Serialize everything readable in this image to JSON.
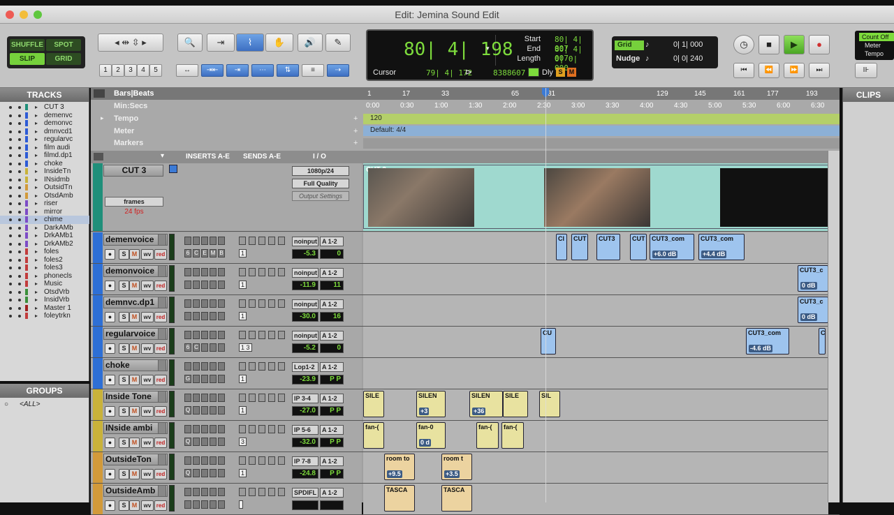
{
  "window": {
    "title": "Edit: Jemina Sound Edit"
  },
  "edit_modes": {
    "shuffle": "SHUFFLE",
    "spot": "SPOT",
    "slip": "SLIP",
    "grid": "GRID"
  },
  "zoom_presets": [
    "1",
    "2",
    "3",
    "4",
    "5"
  ],
  "counter": {
    "main": "80| 4| 198",
    "start_label": "Start",
    "start": "80| 4| 007",
    "end_label": "End",
    "end": "80| 4| 007",
    "length_label": "Length",
    "length": "0| 0| 000",
    "cursor_label": "Cursor",
    "cursor": "79| 4| 172",
    "sample": "8388607",
    "dly": "Dly",
    "s": "S",
    "m": "M"
  },
  "grid": {
    "grid_label": "Grid",
    "grid_value": "0| 1| 000",
    "nudge_label": "Nudge",
    "nudge_value": "0| 0| 240"
  },
  "count_off": {
    "line1": "Count Off",
    "line2": "Meter",
    "line3": "Tempo"
  },
  "tracks_panel": {
    "header": "TRACKS",
    "items": [
      {
        "name": "CUT 3",
        "color": "#1f8f7a"
      },
      {
        "name": "demenvc",
        "color": "#2d5bd6"
      },
      {
        "name": "demonvc",
        "color": "#2d5bd6"
      },
      {
        "name": "dmnvcd1",
        "color": "#2d5bd6"
      },
      {
        "name": "regularvc",
        "color": "#2d5bd6"
      },
      {
        "name": "film audi",
        "color": "#2d5bd6"
      },
      {
        "name": "filmd.dp1",
        "color": "#2d5bd6"
      },
      {
        "name": "choke",
        "color": "#2d5bd6"
      },
      {
        "name": "InsideTn",
        "color": "#c9b23a"
      },
      {
        "name": "INsidmb",
        "color": "#c9b23a"
      },
      {
        "name": "OutsidTn",
        "color": "#d29a3a"
      },
      {
        "name": "OtsdAmb",
        "color": "#d29a3a"
      },
      {
        "name": "riser",
        "color": "#7d4cc7"
      },
      {
        "name": "mirror",
        "color": "#7d4cc7"
      },
      {
        "name": "chime",
        "color": "#7d4cc7"
      },
      {
        "name": "DarkAMb",
        "color": "#7d4cc7"
      },
      {
        "name": "DrkAMb1",
        "color": "#7d4cc7"
      },
      {
        "name": "DrkAMb2",
        "color": "#7d4cc7"
      },
      {
        "name": "foles",
        "color": "#c23c3c"
      },
      {
        "name": "foles2",
        "color": "#c23c3c"
      },
      {
        "name": "foles3",
        "color": "#c23c3c"
      },
      {
        "name": "phonecls",
        "color": "#c23c3c"
      },
      {
        "name": "Music",
        "color": "#c23c3c"
      },
      {
        "name": "OtsdVrb",
        "color": "#3a8f3a"
      },
      {
        "name": "InsidVrb",
        "color": "#3a8f3a"
      },
      {
        "name": "Master 1",
        "color": "#a02020"
      },
      {
        "name": "foleytrkn",
        "color": "#c23c3c"
      }
    ]
  },
  "groups_panel": {
    "header": "GROUPS",
    "item": "<ALL>"
  },
  "clips_panel": {
    "header": "CLIPS"
  },
  "rulers": {
    "bars_beats": "Bars|Beats",
    "min_secs": "Min:Secs",
    "tempo": "Tempo",
    "meter": "Meter",
    "markers": "Markers",
    "tempo_value": "120",
    "meter_value": "Default: 4/4",
    "bar_ticks": [
      "1",
      "17",
      "33",
      "65",
      "81",
      "129",
      "145",
      "161",
      "177",
      "193"
    ],
    "time_ticks": [
      "0:00",
      "0:30",
      "1:00",
      "1:30",
      "2:00",
      "2:30",
      "3:00",
      "3:30",
      "4:00",
      "4:30",
      "5:00",
      "5:30",
      "6:00",
      "6:30"
    ]
  },
  "columns": {
    "inserts": "INSERTS A-E",
    "sends": "SENDS A-E",
    "io": "I / O"
  },
  "video_track": {
    "name": "CUT 3",
    "frames": "frames",
    "fps": "24 fps",
    "format": "1080p/24",
    "quality": "Full Quality",
    "output": "Output Settings",
    "clip_label": "CUT 3"
  },
  "tracks": [
    {
      "name": "demenvoice",
      "color": "#2d6fd6",
      "input": "noinput",
      "output": "A 1-2",
      "volume": "-5.3",
      "pan": "0",
      "sends": "1",
      "inserts": [
        "6",
        "C",
        "E",
        "M",
        "B"
      ]
    },
    {
      "name": "demonvoice",
      "color": "#2d6fd6",
      "input": "noinput",
      "output": "A 1-2",
      "volume": "-11.9",
      "pan": "11",
      "sends": "1",
      "inserts": []
    },
    {
      "name": "demnvc.dp1",
      "color": "#2d6fd6",
      "input": "noinput",
      "output": "A 1-2",
      "volume": "-30.0",
      "pan": "16",
      "sends": "1",
      "inserts": []
    },
    {
      "name": "regularvoice",
      "color": "#2d6fd6",
      "input": "noinput",
      "output": "A 1-2",
      "volume": "-5.2",
      "pan": "0",
      "sends": "1  3",
      "inserts": [
        "6",
        "C"
      ]
    },
    {
      "name": "choke",
      "color": "#2d6fd6",
      "input": "Lop1-2",
      "output": "A 1-2",
      "volume": "-23.9",
      "pan": "P  P",
      "sends": "1",
      "inserts": [
        "G"
      ]
    },
    {
      "name": "Inside Tone",
      "color": "#c9b23a",
      "input": "IP 3-4",
      "output": "A 1-2",
      "volume": "-27.0",
      "pan": "P  P",
      "sends": "1",
      "inserts": [
        "Q"
      ]
    },
    {
      "name": "INside ambi",
      "color": "#c9b23a",
      "input": "IP 5-6",
      "output": "A 1-2",
      "volume": "-32.0",
      "pan": "P  P",
      "sends": "3",
      "inserts": [
        "Q"
      ]
    },
    {
      "name": "OutsideTon",
      "color": "#d29a3a",
      "input": "IP 7-8",
      "output": "A 1-2",
      "volume": "-24.8",
      "pan": "P  P",
      "sends": "1",
      "inserts": [
        "Q"
      ]
    },
    {
      "name": "OutsideAmb",
      "color": "#d29a3a",
      "input": "SPDIFL",
      "output": "A 1-2",
      "volume": "",
      "pan": "",
      "sends": "",
      "inserts": []
    }
  ],
  "clips": {
    "demen": [
      {
        "label": "Cl",
        "gain": ""
      },
      {
        "label": "CUT",
        "gain": ""
      },
      {
        "label": "CUT3",
        "gain": ""
      },
      {
        "label": "CUT",
        "gain": ""
      },
      {
        "label": "CUT3_com",
        "gain": "+6.0 dB"
      },
      {
        "label": "CUT3_com",
        "gain": "+4.4 dB"
      }
    ],
    "demon": [
      {
        "label": "CUT3_c",
        "gain": "0 dB"
      }
    ],
    "demnvc": [
      {
        "label": "CUT3_c",
        "gain": "0 dB"
      }
    ],
    "regular": [
      {
        "label": "CU",
        "gain": ""
      },
      {
        "label": "CUT3_com",
        "gain": "-4.6 dB"
      },
      {
        "label": "C",
        "gain": ""
      }
    ],
    "inside_tone": [
      {
        "label": "SILE",
        "gain": ""
      },
      {
        "label": "SILEN",
        "gain": "+3"
      },
      {
        "label": "SILEN",
        "gain": "+36"
      },
      {
        "label": "SILE",
        "gain": ""
      },
      {
        "label": "SIL",
        "gain": ""
      }
    ],
    "inside_amb": [
      {
        "label": "fan-(",
        "gain": ""
      },
      {
        "label": "fan-0",
        "gain": "0 d"
      },
      {
        "label": "fan-(",
        "gain": ""
      },
      {
        "label": "fan-(",
        "gain": ""
      }
    ],
    "outside_ton": [
      {
        "label": "room to",
        "gain": "+9.5"
      },
      {
        "label": "room t",
        "gain": "+3.5"
      }
    ],
    "outside_amb": [
      {
        "label": "TASCA",
        "gain": ""
      },
      {
        "label": "TASCA",
        "gain": ""
      }
    ]
  },
  "colors": {
    "lcd_green": "#7ddb3c",
    "clip_blue": "#9ec4ee",
    "video_teal": "#9fd9cf",
    "tempo_green": "#b4cf6a",
    "meter_blue": "#8cb0d6"
  }
}
